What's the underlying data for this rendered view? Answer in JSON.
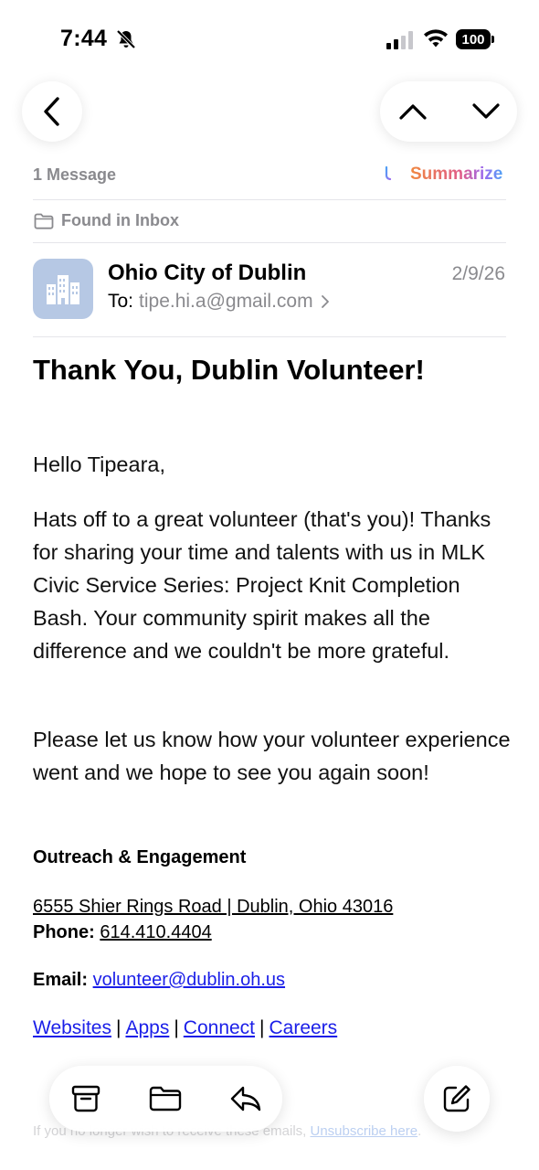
{
  "status_bar": {
    "time": "7:44",
    "battery": "100",
    "icons": [
      "bell-slash-icon",
      "signal-icon",
      "wifi-icon",
      "battery-icon"
    ]
  },
  "nav": {
    "back_icon": "chevron-left-icon",
    "up_icon": "chevron-up-icon",
    "down_icon": "chevron-down-icon"
  },
  "thread": {
    "message_count": "1 Message",
    "summarize_label": "Summarize",
    "summarize_icon": "summarize-icon",
    "found_in": "Found in Inbox",
    "found_icon": "folder-icon"
  },
  "message": {
    "sender": "Ohio City of Dublin",
    "date": "2/9/26",
    "to_label": "To:",
    "to_address": "tipe.hi.a@gmail.com",
    "avatar_icon": "building-icon",
    "avatar_color": "#b6c8e4",
    "subject": "Thank You, Dublin Volunteer!",
    "greeting": "Hello Tipeara,",
    "paragraph1": "Hats off to a great volunteer (that's you)! Thanks for sharing your time and talents with us in MLK Civic Service Series: Project Knit Completion Bash. Your community spirit makes all the difference and we couldn't be more grateful.",
    "paragraph2": "Please let us know how your volunteer experience went and we hope to see you again soon!",
    "signature_title": "Outreach & Engagement",
    "address": "6555 Shier Rings Road | Dublin, Ohio 43016",
    "phone_label": "Phone:",
    "phone": "614.410.4404",
    "email_label": "Email:",
    "email": "volunteer@dublin.oh.us",
    "links": [
      "Websites",
      "Apps",
      "Connect",
      "Careers"
    ],
    "link_separator": "|",
    "footer_text": "If you no longer wish to receive these emails,",
    "unsubscribe": "Unsubscribe here",
    "footer_end": ".",
    "link_color": "#1a1ee8"
  },
  "toolbar": {
    "archive_icon": "archive-icon",
    "move_icon": "folder-icon",
    "reply_icon": "reply-icon",
    "compose_icon": "compose-icon"
  }
}
